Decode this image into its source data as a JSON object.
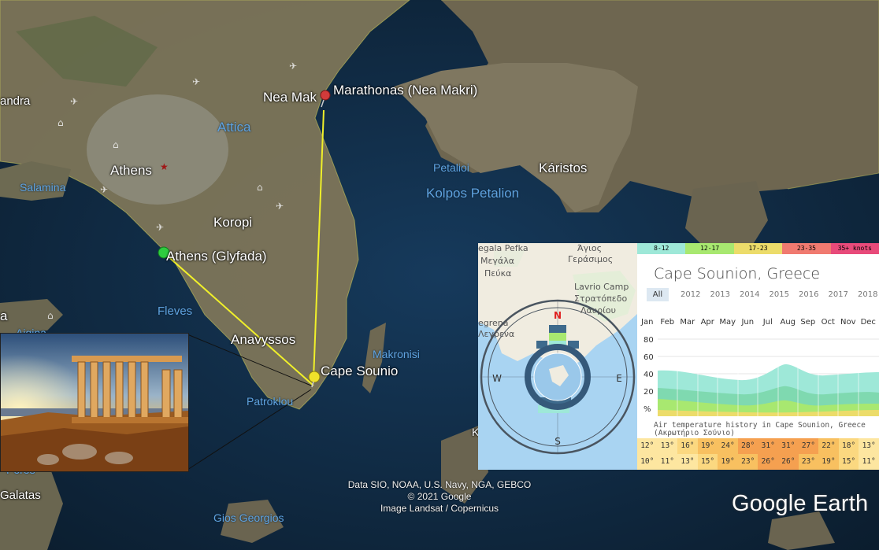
{
  "map": {
    "places": [
      {
        "id": "andra",
        "text": "andra",
        "style": "white place-md"
      },
      {
        "id": "attica",
        "text": "Attica",
        "style": "water place-lg"
      },
      {
        "id": "athens",
        "text": "Athens",
        "style": "white place-lg"
      },
      {
        "id": "salamina",
        "text": "Salamina",
        "style": "water place-sm"
      },
      {
        "id": "koropi",
        "text": "Koropi",
        "style": "white place-lg"
      },
      {
        "id": "glyfada",
        "text": "Athens (Glyfada)",
        "style": "white place-lg"
      },
      {
        "id": "fleves",
        "text": "Fleves",
        "style": "water place-md"
      },
      {
        "id": "anavyssos",
        "text": "Anavyssos",
        "style": "white place-lg"
      },
      {
        "id": "cape-sounio",
        "text": "Cape Sounio",
        "style": "white place-lg"
      },
      {
        "id": "patroklou",
        "text": "Patroklou",
        "style": "water place-sm"
      },
      {
        "id": "makronisi",
        "text": "Makronisi",
        "style": "water place-sm"
      },
      {
        "id": "nea-mak",
        "text": "Nea Mak",
        "style": "white place-lg"
      },
      {
        "id": "marathonas",
        "text": "Marathonas (Nea Makri)",
        "style": "white place-lg"
      },
      {
        "id": "petalioi",
        "text": "Petalioi",
        "style": "water place-sm"
      },
      {
        "id": "karistos",
        "text": "Káristos",
        "style": "white place-lg"
      },
      {
        "id": "kolpos",
        "text": "Kolpos Petalion",
        "style": "water place-lg"
      },
      {
        "id": "galatas",
        "text": "Galatas",
        "style": "white place-md"
      },
      {
        "id": "poros",
        "text": "Poros",
        "style": "water place-sm"
      },
      {
        "id": "gios",
        "text": "Gios Georgios",
        "style": "water place-sm"
      },
      {
        "id": "a-left",
        "text": "a",
        "style": "white place-lg"
      },
      {
        "id": "aigina",
        "text": "Aigina",
        "style": "water place-sm"
      },
      {
        "id": "k-right",
        "text": "K",
        "style": "white place-sm"
      }
    ],
    "attribution": [
      "Data SIO, NOAA, U.S. Navy, NGA, GEBCO",
      "© 2021 Google",
      "Image Landsat / Copernicus"
    ],
    "logo": "Google Earth"
  },
  "windmap": {
    "labels": [
      "egala Pefka",
      "Μεγάλα",
      "Πεύκα",
      "Άγιος",
      "Γεράσιμος",
      "Lavrio Camp",
      "Στρατόπεδο",
      "Λαυρίου",
      "egrena",
      "Λεγρενα"
    ],
    "compass": {
      "n": "N",
      "e": "E",
      "s": "S",
      "w": "W"
    }
  },
  "stats": {
    "legend": [
      {
        "text": "8-12",
        "color": "#9ee8d8"
      },
      {
        "text": "12-17",
        "color": "#a8e870"
      },
      {
        "text": "17-23",
        "color": "#ecdc6a"
      },
      {
        "text": "23-35",
        "color": "#f07a70"
      },
      {
        "text": "35+ knots",
        "color": "#e84a7a"
      }
    ],
    "title": "Cape Sounion, Greece",
    "years": [
      "All",
      "2012",
      "2013",
      "2014",
      "2015",
      "2016",
      "2017",
      "2018"
    ],
    "months": [
      "Jan",
      "Feb",
      "Mar",
      "Apr",
      "May",
      "Jun",
      "Jul",
      "Aug",
      "Sep",
      "Oct",
      "Nov",
      "Dec"
    ],
    "yticks": [
      "80",
      "60",
      "40",
      "20",
      "%"
    ],
    "history_title_1": "Air temperature history in Cape Sounion, Greece",
    "history_title_2": "(Ακρωτήριο Σούνιο)",
    "temp_high": [
      "12°",
      "13°",
      "16°",
      "19°",
      "24°",
      "28°",
      "31°",
      "31°",
      "27°",
      "22°",
      "18°",
      "13°"
    ],
    "temp_low": [
      "10°",
      "11°",
      "13°",
      "15°",
      "19°",
      "23°",
      "26°",
      "26°",
      "23°",
      "19°",
      "15°",
      "11°"
    ]
  }
}
